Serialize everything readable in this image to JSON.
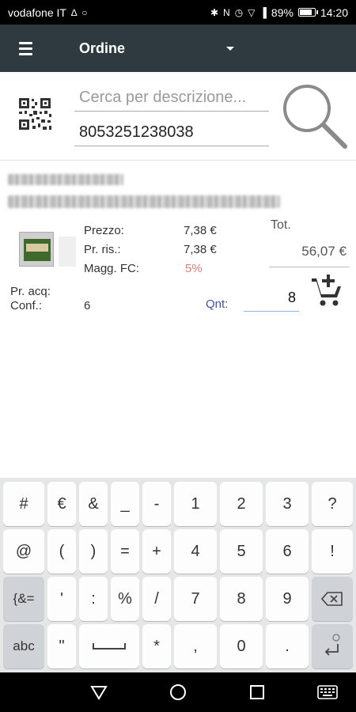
{
  "status_bar": {
    "carrier": "vodafone IT",
    "battery": "89%",
    "battery_level": 0.89,
    "time": "14:20"
  },
  "toolbar": {
    "title": "Ordine"
  },
  "search": {
    "placeholder": "Cerca per descrizione...",
    "barcode_value": "8053251238038"
  },
  "product": {
    "labels": {
      "price": "Prezzo:",
      "reserved_price": "Pr. ris.:",
      "markup": "Magg. FC:",
      "purchase_price": "Pr. acq:",
      "package": "Conf.:",
      "quantity": "Qnt:",
      "total": "Tot."
    },
    "price": "7,38 €",
    "reserved_price": "7,38 €",
    "markup": "5%",
    "package": "6",
    "total": "56,07 €",
    "quantity": "8"
  },
  "keyboard": {
    "rows": [
      [
        "#",
        "€",
        "&",
        "_",
        "-",
        "1",
        "2",
        "3",
        "?"
      ],
      [
        "@",
        "(",
        ")",
        "=",
        "+",
        "4",
        "5",
        "6",
        "!"
      ],
      [
        "{&=",
        "'",
        ":",
        "%",
        "/",
        "7",
        "8",
        "9"
      ],
      [
        "abc",
        "\"",
        "*",
        ",",
        "0",
        "."
      ]
    ]
  },
  "colors": {
    "toolbar": "#2f3a40",
    "markup_text": "#e07a7a",
    "quantity_label": "#3f51b5"
  }
}
